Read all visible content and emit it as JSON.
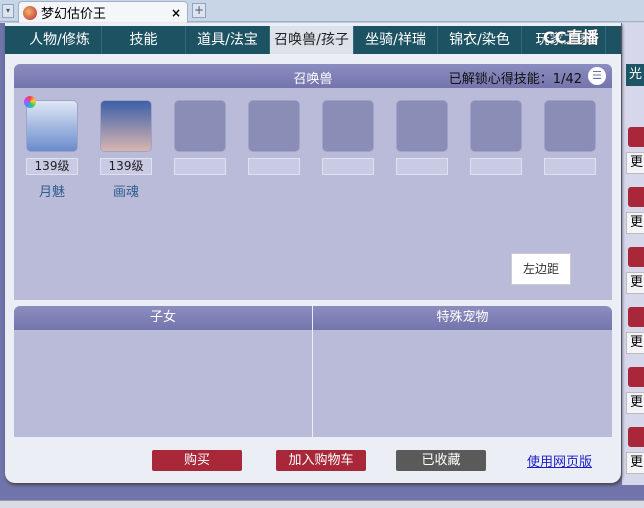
{
  "browser": {
    "tab_title": "梦幻估价王",
    "close": "×",
    "new_tab": "+",
    "menu": "▾"
  },
  "nav": {
    "tabs": [
      "人物/修炼",
      "技能",
      "道具/法宝",
      "召唤兽/孩子",
      "坐骑/祥瑞",
      "锦衣/染色",
      "玩家之家"
    ],
    "active": 3
  },
  "watermark": "CC直播",
  "pets": {
    "title": "召唤兽",
    "unlocked_label": "已解锁心得技能：1/42",
    "menu_icon": "list-icon",
    "items": [
      {
        "level": "139级",
        "name": "月魅"
      },
      {
        "level": "139级",
        "name": "画魂"
      },
      {
        "level": "",
        "name": ""
      },
      {
        "level": "",
        "name": ""
      },
      {
        "level": "",
        "name": ""
      },
      {
        "level": "",
        "name": ""
      },
      {
        "level": "",
        "name": ""
      },
      {
        "level": "",
        "name": ""
      }
    ]
  },
  "tooltip": "左边距",
  "sections": {
    "children": "子女",
    "special": "特殊宠物"
  },
  "actions": {
    "buy": "购买",
    "add_cart": "加入购物车",
    "favorited": "已收藏",
    "web": "使用网页版"
  },
  "right_col": {
    "top": "光",
    "more": "更"
  },
  "colors": {
    "teal": "#1d5263",
    "purple": "#7375ac",
    "red": "#a8283a",
    "grey": "#5a5a5a"
  }
}
